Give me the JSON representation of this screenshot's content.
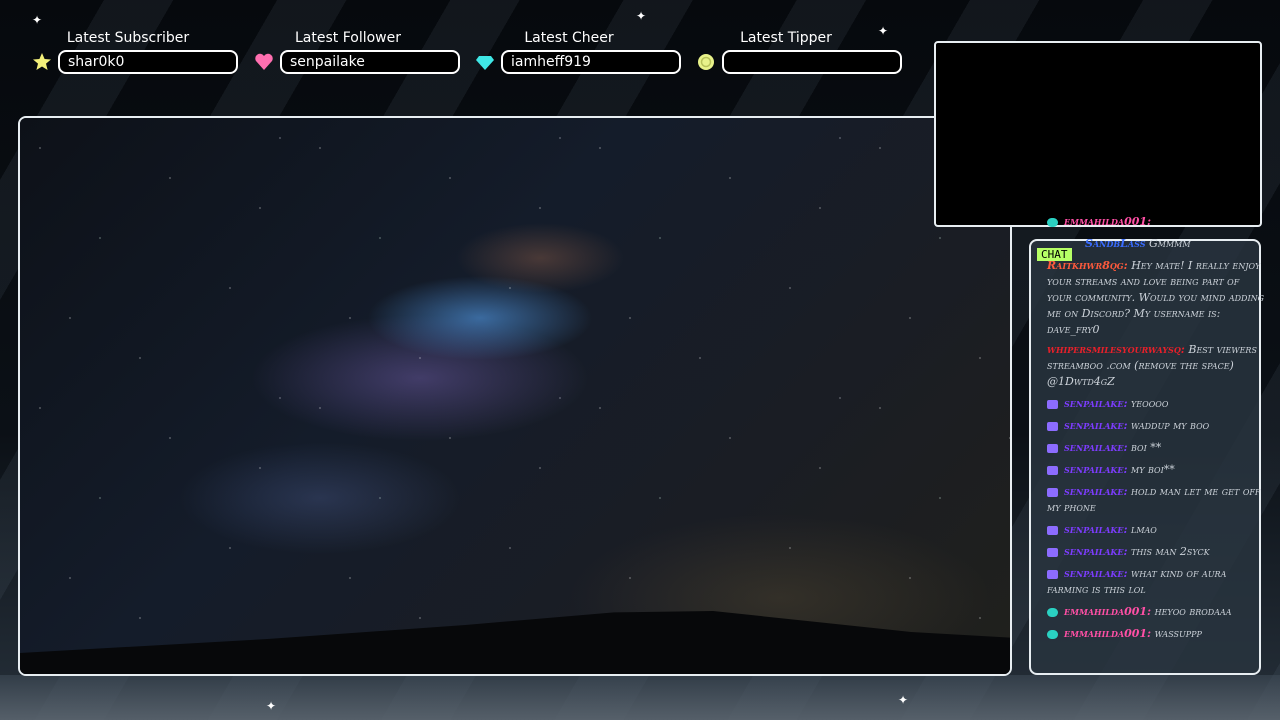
{
  "stats": [
    {
      "label": "Latest Subscriber",
      "value": "shar0k0",
      "icon": "star-icon",
      "color": "#f3f07a"
    },
    {
      "label": "Latest Follower",
      "value": "senpailake",
      "icon": "heart-icon",
      "color": "#ff6fb0"
    },
    {
      "label": "Latest Cheer",
      "value": "iamheff919",
      "icon": "gem-icon",
      "color": "#3fe7e6"
    },
    {
      "label": "Latest Tipper",
      "value": "",
      "icon": "coin-icon",
      "color": "#e8f28a"
    }
  ],
  "chat": {
    "tag": "CHAT",
    "top_user": "emmahilda001:",
    "top_prefix": "SandbLass",
    "top_text": "Gmmmm",
    "messages": [
      {
        "name": "Raitkhwr8qg:",
        "text": "Hey mate! I really enjoy your streams and love being part of your community. Would you mind adding me on Discord? My username is: dave_fry0",
        "color": "orange"
      },
      {
        "name": "whipersmilesyourwaysq:",
        "text": "Best viewers streamboo .com (remove the space) @1Dwtd4gZ",
        "color": "red"
      },
      {
        "name": "senpailake:",
        "text": "yeoooo",
        "color": "purple"
      },
      {
        "name": "senpailake:",
        "text": "waddup my boo",
        "color": "purple"
      },
      {
        "name": "senpailake:",
        "text": "boi **",
        "color": "purple"
      },
      {
        "name": "senpailake:",
        "text": "my boi**",
        "color": "purple"
      },
      {
        "name": "senpailake:",
        "text": "hold man let me get off my phone",
        "color": "purple"
      },
      {
        "name": "senpailake:",
        "text": "lmao",
        "color": "purple"
      },
      {
        "name": "senpailake:",
        "text": "this man 2syck",
        "color": "purple"
      },
      {
        "name": "senpailake:",
        "text": "what kind of aura farming is this lol",
        "color": "purple"
      },
      {
        "name": "emmahilda001:",
        "text": "heyoo brodaaa",
        "color": "pink"
      },
      {
        "name": "emmahilda001:",
        "text": "wassuppp",
        "color": "pink"
      }
    ]
  }
}
